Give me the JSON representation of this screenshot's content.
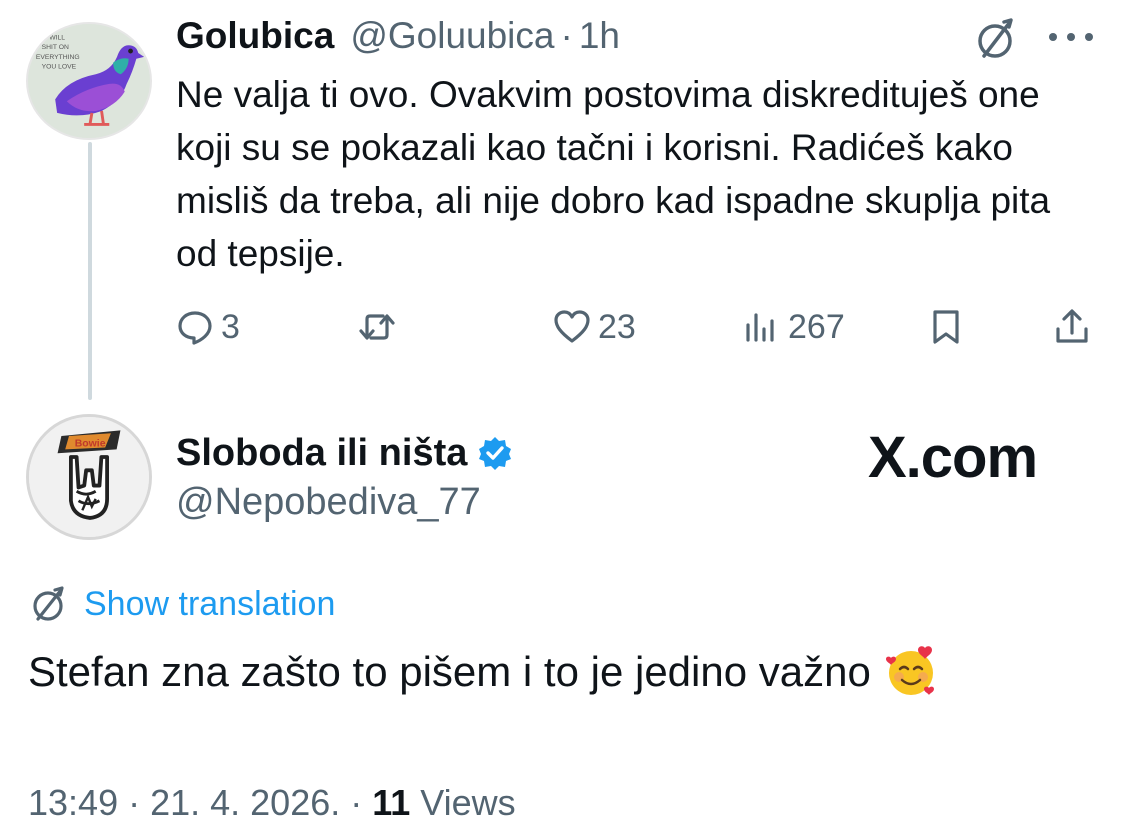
{
  "reply_tweet": {
    "author_name": "Golubica",
    "author_handle": "@Goluubica",
    "separator": "·",
    "time": "1h",
    "avatar_text": [
      "I WILL",
      "SHIT ON",
      "EVERYTHING",
      "YOU LOVE"
    ],
    "text": "Ne valja ti ovo. Ovakvim postovima diskredituješ one koji su se pokazali kao tačni i korisni. Radićeš kako misliš da treba, ali nije dobro kad ispadne skuplja pita od tepsije.",
    "actions": {
      "replies": "3",
      "likes": "23",
      "views": "267"
    }
  },
  "main_tweet": {
    "author_name": "Sloboda ili ništa",
    "author_handle": "@Nepobediva_77",
    "verified": true,
    "avatar_text": "Bowie",
    "watermark": "X.com",
    "show_translation": "Show translation",
    "text": "Stefan zna zašto to pišem i to je jedino važno",
    "emoji": "smiling-face-with-hearts",
    "timestamp": "13:49 · 21. 4. 2026. · ",
    "views_count": "11",
    "views_label": " Views"
  },
  "colors": {
    "accent": "#1d9bf0",
    "secondary_text": "#536471",
    "primary_text": "#0f1419",
    "thread_line": "#cfd9de"
  }
}
